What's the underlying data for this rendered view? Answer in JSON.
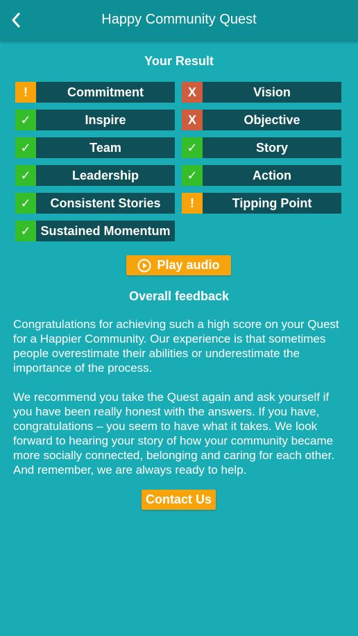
{
  "header": {
    "title": "Happy Community Quest"
  },
  "result": {
    "title": "Your Result",
    "items": [
      {
        "label": "Commitment",
        "status": "warn",
        "glyph": "!"
      },
      {
        "label": "Vision",
        "status": "fail",
        "glyph": "X"
      },
      {
        "label": "Inspire",
        "status": "pass",
        "glyph": "✓"
      },
      {
        "label": "Objective",
        "status": "fail",
        "glyph": "X"
      },
      {
        "label": "Team",
        "status": "pass",
        "glyph": "✓"
      },
      {
        "label": "Story",
        "status": "pass",
        "glyph": "✓"
      },
      {
        "label": "Leadership",
        "status": "pass",
        "glyph": "✓"
      },
      {
        "label": "Action",
        "status": "pass",
        "glyph": "✓"
      },
      {
        "label": "Consistent Stories",
        "status": "pass",
        "glyph": "✓"
      },
      {
        "label": "Tipping Point",
        "status": "warn",
        "glyph": "!"
      },
      {
        "label": "Sustained Momentum",
        "status": "pass",
        "glyph": "✓"
      }
    ]
  },
  "audio": {
    "play_label": "Play audio"
  },
  "feedback": {
    "title": "Overall feedback",
    "paragraph1": "Congratulations for achieving such a high score on your Quest for a Happier Community. Our experience is that sometimes people overestimate their abilities or underestimate the importance of the process.",
    "paragraph2": "We recommend you take the Quest again and ask yourself if you have been really honest with the answers. If you have, congratulations – you seem to have what it takes. We look forward to hearing your story of how your community became more socially connected, belonging and caring for each other. And remember, we are always ready to help."
  },
  "contact": {
    "label": "Contact Us"
  },
  "colors": {
    "background": "#1aacb5",
    "header": "#0e8f95",
    "item_bg": "#0f4f57",
    "pass": "#35be2a",
    "warn": "#f7a30c",
    "fail": "#d05c3e",
    "button": "#f7a30c"
  }
}
